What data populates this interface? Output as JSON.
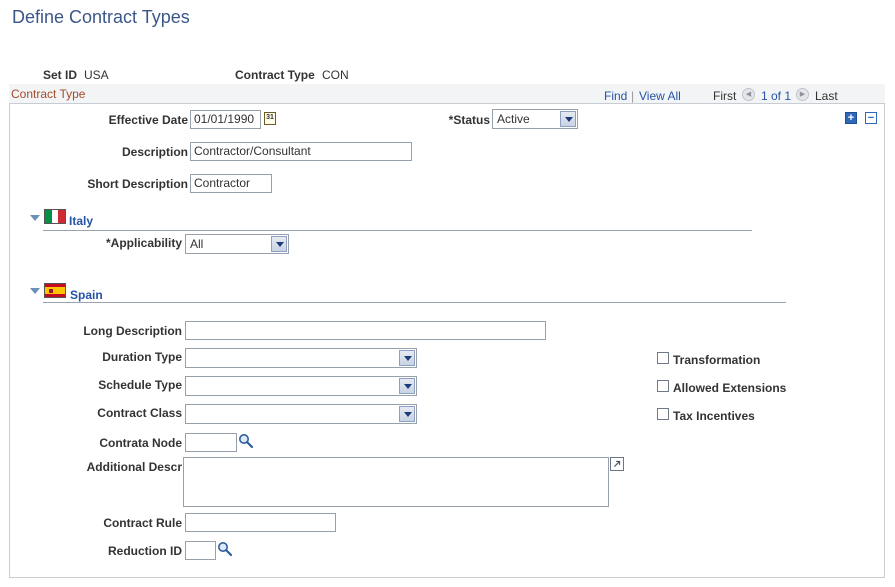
{
  "page": {
    "title": "Define Contract Types"
  },
  "keys": {
    "setid_label": "Set ID",
    "setid_value": "USA",
    "contract_type_label": "Contract Type",
    "contract_type_value": "CON"
  },
  "grid": {
    "title": "Contract Type",
    "find": "Find",
    "separator": "|",
    "view_all": "View All",
    "first": "First",
    "count": "1 of 1",
    "last": "Last"
  },
  "form": {
    "effective_date_label": "Effective Date",
    "effective_date_value": "01/01/1990",
    "status_label": "*Status",
    "status_value": "Active",
    "description_label": "Description",
    "description_value": "Contractor/Consultant",
    "short_description_label": "Short Description",
    "short_description_value": "Contractor"
  },
  "italy": {
    "title": "Italy",
    "applicability_label": "*Applicability",
    "applicability_value": "All"
  },
  "spain": {
    "title": "Spain",
    "long_description_label": "Long Description",
    "duration_type_label": "Duration Type",
    "schedule_type_label": "Schedule Type",
    "contract_class_label": "Contract Class",
    "contrata_node_label": "Contrata Node",
    "additional_descr_label": "Additional Descr",
    "contract_rule_label": "Contract Rule",
    "reduction_id_label": "Reduction ID",
    "transformation_label": "Transformation",
    "allowed_extensions_label": "Allowed Extensions",
    "tax_incentives_label": "Tax Incentives"
  },
  "colors": {
    "title": "#3b5787",
    "grid_title": "#a34d2a",
    "link": "#2653a8"
  }
}
